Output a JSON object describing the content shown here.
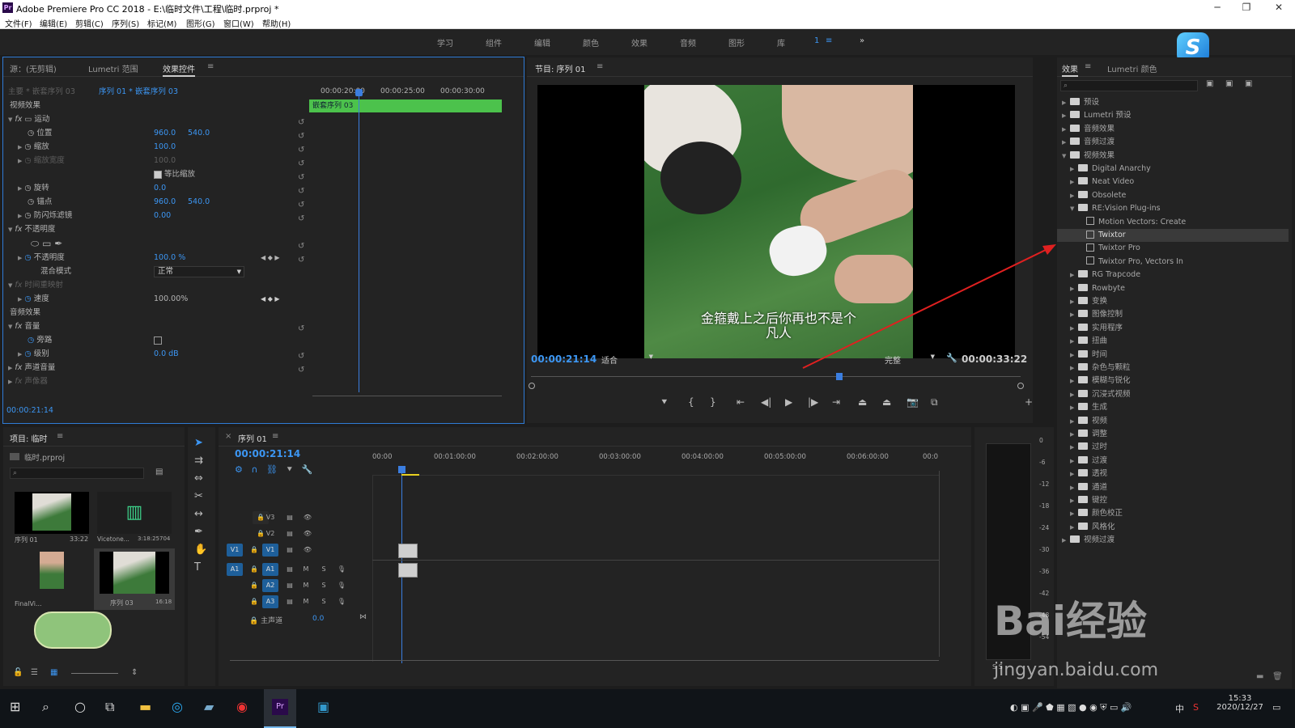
{
  "window": {
    "title": "Adobe Premiere Pro CC 2018 - E:\\临时文件\\工程\\临时.prproj *",
    "app_icon": "Pr"
  },
  "menu": [
    "文件(F)",
    "编辑(E)",
    "剪辑(C)",
    "序列(S)",
    "标记(M)",
    "图形(G)",
    "窗口(W)",
    "帮助(H)"
  ],
  "workspaces": [
    "学习",
    "组件",
    "编辑",
    "颜色",
    "效果",
    "音频",
    "图形",
    "库",
    "1",
    "≡",
    "»"
  ],
  "effect_controls": {
    "tabs": [
      "源：(无剪辑)",
      "Lumetri 范围",
      "效果控件"
    ],
    "source_label": "主要 * 嵌套序列 03",
    "seq_label": "序列 01 * 嵌套序列 03",
    "times": [
      "00:00:20:00",
      "00:00:25:00",
      "00:00:30:00"
    ],
    "clip_name": "嵌套序列 03",
    "video_header": "视频效果",
    "motion": "运动",
    "props": [
      {
        "name": "位置",
        "v1": "960.0",
        "v2": "540.0"
      },
      {
        "name": "缩放",
        "v1": "100.0",
        "v2": ""
      },
      {
        "name": "缩放宽度",
        "v1": "100.0",
        "v2": ""
      },
      {
        "name": "等比缩放",
        "v1": "",
        "v2": ""
      },
      {
        "name": "旋转",
        "v1": "0.0",
        "v2": ""
      },
      {
        "name": "锚点",
        "v1": "960.0",
        "v2": "540.0"
      },
      {
        "name": "防闪烁滤镜",
        "v1": "0.00",
        "v2": ""
      }
    ],
    "opacity": "不透明度",
    "opacity_prop": "不透明度",
    "opacity_val": "100.0 %",
    "blend": "混合模式",
    "blend_val": "正常",
    "time_remap": "时间重映射",
    "speed": "速度",
    "speed_val": "100.00%",
    "audio_header": "音频效果",
    "volume": "音量",
    "bypass": "旁路",
    "level": "级别",
    "level_val": "0.0 dB",
    "channel_vol": "声道音量",
    "panner": "声像器",
    "timecode": "00:00:21:14"
  },
  "program": {
    "tab": "节目: 序列 01",
    "subtitle_line1": "金箍戴上之后你再也不是个",
    "subtitle_line2": "凡人",
    "timecode": "00:00:21:14",
    "fit": "适合",
    "quality": "完整",
    "duration": "00:00:33:22"
  },
  "effects": {
    "tabs": [
      "效果",
      "Lumetri 颜色"
    ],
    "tree": [
      {
        "label": "预设",
        "level": 0,
        "type": "folder"
      },
      {
        "label": "Lumetri 预设",
        "level": 0,
        "type": "folder"
      },
      {
        "label": "音频效果",
        "level": 0,
        "type": "folder"
      },
      {
        "label": "音频过渡",
        "level": 0,
        "type": "folder"
      },
      {
        "label": "视频效果",
        "level": 0,
        "type": "folder",
        "open": true
      },
      {
        "label": "Digital Anarchy",
        "level": 1,
        "type": "folder"
      },
      {
        "label": "Neat Video",
        "level": 1,
        "type": "folder"
      },
      {
        "label": "Obsolete",
        "level": 1,
        "type": "folder"
      },
      {
        "label": "RE:Vision Plug-ins",
        "level": 1,
        "type": "folder",
        "open": true
      },
      {
        "label": "Motion Vectors: Create",
        "level": 2,
        "type": "fx"
      },
      {
        "label": "Twixtor",
        "level": 2,
        "type": "fx",
        "selected": true
      },
      {
        "label": "Twixtor Pro",
        "level": 2,
        "type": "fx"
      },
      {
        "label": "Twixtor Pro, Vectors In",
        "level": 2,
        "type": "fx"
      },
      {
        "label": "RG Trapcode",
        "level": 1,
        "type": "folder"
      },
      {
        "label": "Rowbyte",
        "level": 1,
        "type": "folder"
      },
      {
        "label": "变换",
        "level": 1,
        "type": "folder"
      },
      {
        "label": "图像控制",
        "level": 1,
        "type": "folder"
      },
      {
        "label": "实用程序",
        "level": 1,
        "type": "folder"
      },
      {
        "label": "扭曲",
        "level": 1,
        "type": "folder"
      },
      {
        "label": "时间",
        "level": 1,
        "type": "folder"
      },
      {
        "label": "杂色与颗粒",
        "level": 1,
        "type": "folder"
      },
      {
        "label": "模糊与锐化",
        "level": 1,
        "type": "folder"
      },
      {
        "label": "沉浸式视频",
        "level": 1,
        "type": "folder"
      },
      {
        "label": "生成",
        "level": 1,
        "type": "folder"
      },
      {
        "label": "视频",
        "level": 1,
        "type": "folder"
      },
      {
        "label": "调整",
        "level": 1,
        "type": "folder"
      },
      {
        "label": "过时",
        "level": 1,
        "type": "folder"
      },
      {
        "label": "过渡",
        "level": 1,
        "type": "folder"
      },
      {
        "label": "透视",
        "level": 1,
        "type": "folder"
      },
      {
        "label": "通道",
        "level": 1,
        "type": "folder"
      },
      {
        "label": "键控",
        "level": 1,
        "type": "folder"
      },
      {
        "label": "颜色校正",
        "level": 1,
        "type": "folder"
      },
      {
        "label": "风格化",
        "level": 1,
        "type": "folder"
      },
      {
        "label": "视频过渡",
        "level": 0,
        "type": "folder"
      }
    ]
  },
  "project": {
    "tab": "项目: 临时",
    "file": "临时.prproj",
    "items": [
      {
        "name": "序列 01",
        "dur": "33:22"
      },
      {
        "name": "Vicetone...",
        "dur": "3:18:25704"
      },
      {
        "name": "FinalVi...",
        "dur": ""
      },
      {
        "name": "序列 03",
        "dur": "16:18"
      }
    ]
  },
  "timeline": {
    "tab": "序列 01",
    "timecode": "00:00:21:14",
    "ruler": [
      "00:00",
      "00:01:00:00",
      "00:02:00:00",
      "00:03:00:00",
      "00:04:00:00",
      "00:05:00:00",
      "00:06:00:00",
      "00:0"
    ],
    "tracks": [
      "V3",
      "V2",
      "V1",
      "A1",
      "A2",
      "A3"
    ],
    "master": "主声道",
    "master_val": "0.0",
    "src_v": "V1",
    "src_a": "A1",
    "m": "M",
    "s": "S"
  },
  "meter": {
    "scale": [
      "0",
      "-6",
      "-12",
      "-18",
      "-24",
      "-30",
      "-36",
      "-42",
      "-48",
      "-54"
    ],
    "bottom": "S S"
  },
  "watermark": {
    "brand": "Bai经验",
    "url": "jingyan.baidu.com"
  },
  "taskbar": {
    "time": "15:33",
    "date": "2020/12/27",
    "ime": "中"
  },
  "colors": {
    "accent": "#2f7bd6",
    "clip_green": "#4cc24c",
    "timecode_blue": "#3c96f3",
    "playhead": "#3b7ee0"
  }
}
